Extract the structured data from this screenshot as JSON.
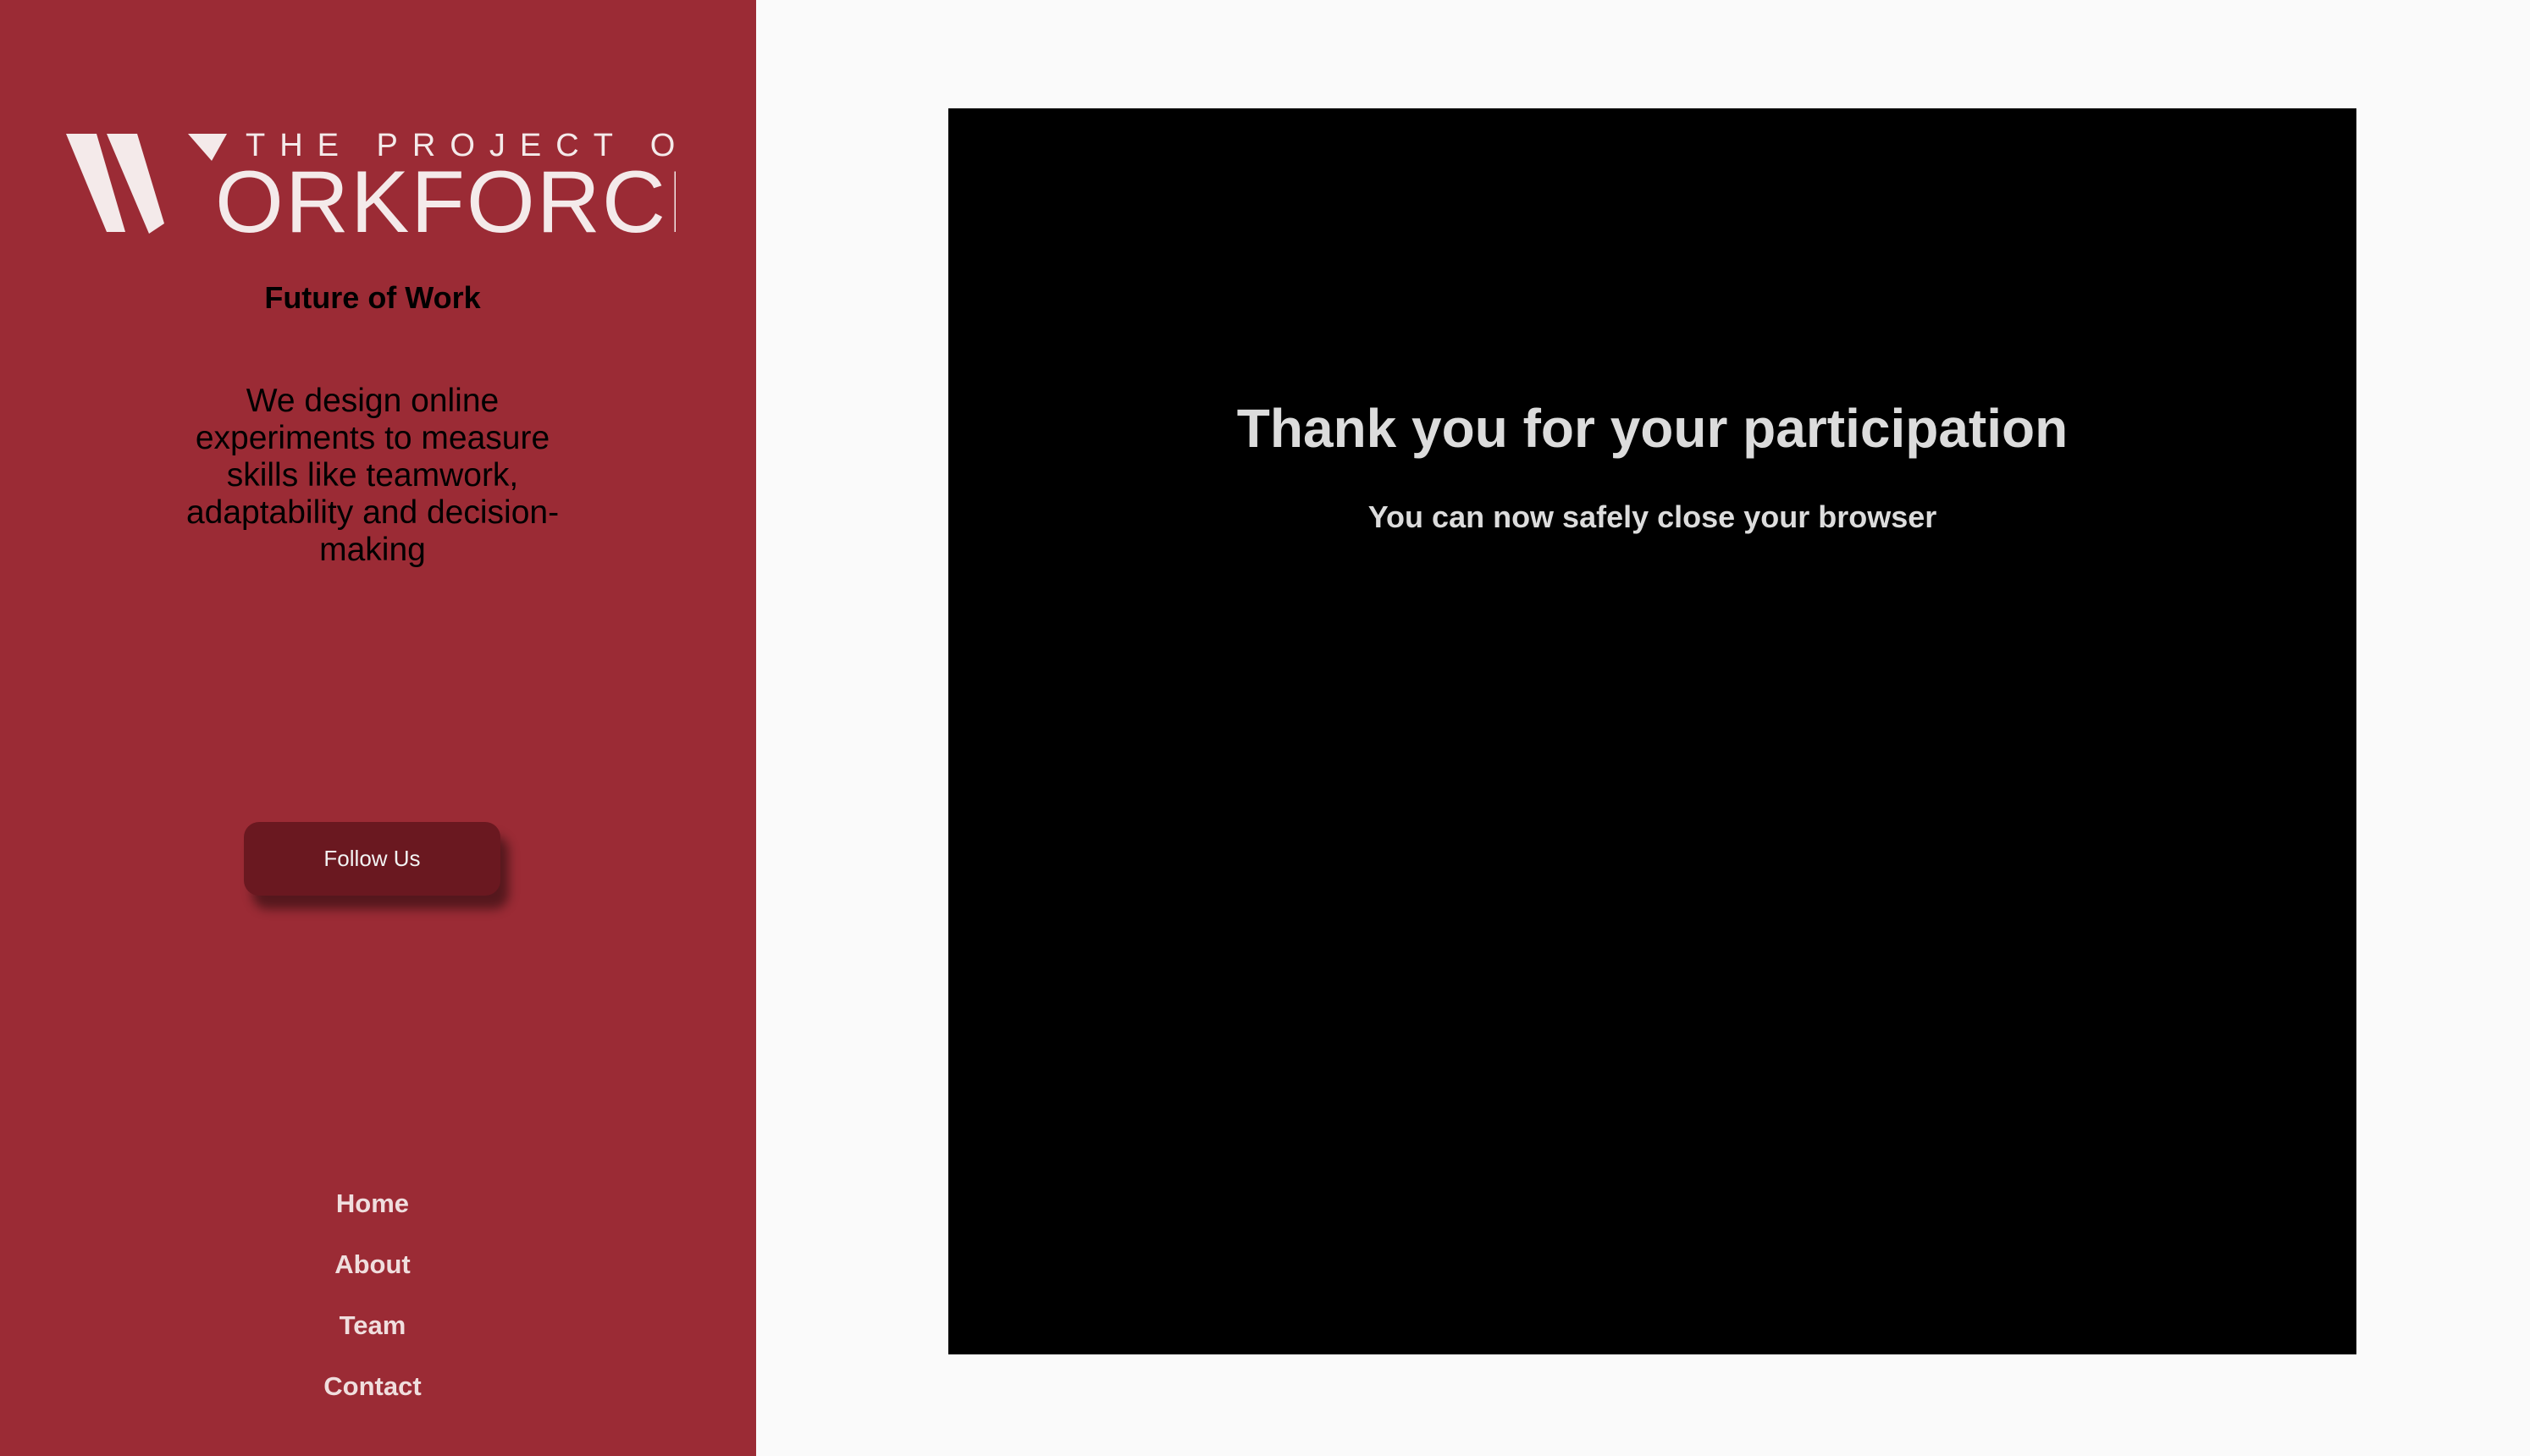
{
  "sidebar": {
    "logo": {
      "line1": "THE PROJECT ON",
      "line2": "WORKFORCE",
      "line2_rest": "ORKFORCE"
    },
    "tagline": "Future of Work",
    "description": "We design online experiments to measure skills like teamwork, adaptability and decision-making",
    "follow_button": "Follow Us",
    "nav": [
      "Home",
      "About",
      "Team",
      "Contact"
    ]
  },
  "main": {
    "title": "Thank you for your participation",
    "subtitle": "You can now safely close your browser"
  },
  "colors": {
    "sidebar_bg": "#9b2b35",
    "button_bg": "#6a1820",
    "page_bg": "#fafafa",
    "frame_bg": "#000000",
    "frame_text": "#dcdcdc"
  }
}
